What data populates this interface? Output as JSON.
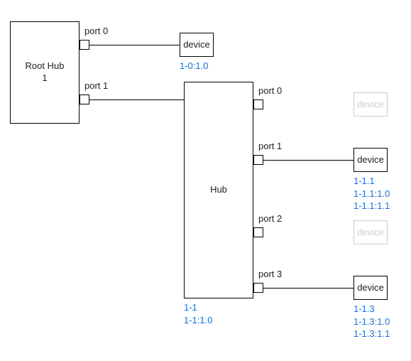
{
  "rootHub": {
    "label": "Root Hub\n1",
    "ports": {
      "p0": {
        "label": "port 0"
      },
      "p1": {
        "label": "port 1"
      }
    }
  },
  "device0": {
    "label": "device",
    "addr": "1-0:1.0"
  },
  "hub": {
    "label": "Hub",
    "addr": "1-1\n1-1:1.0",
    "ports": {
      "p0": {
        "label": "port 0"
      },
      "p1": {
        "label": "port 1"
      },
      "p2": {
        "label": "port 2"
      },
      "p3": {
        "label": "port 3"
      }
    }
  },
  "devGhost0": {
    "label": "device"
  },
  "dev1": {
    "label": "device",
    "addr": "1-1.1\n1-1.1:1.0\n1-1.1:1.1"
  },
  "devGhost2": {
    "label": "device"
  },
  "dev3": {
    "label": "device",
    "addr": "1-1.3\n1-1.3:1.0\n1-1.3:1.1"
  }
}
